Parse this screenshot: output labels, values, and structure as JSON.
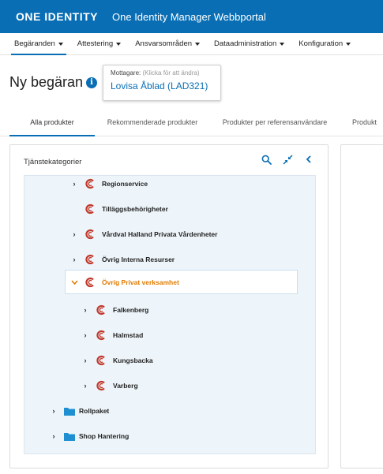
{
  "header": {
    "logo_text": "ONE IDENTITY",
    "app_title": "One Identity Manager Webbportal"
  },
  "menu": {
    "items": [
      {
        "label": "Begäranden"
      },
      {
        "label": "Attestering"
      },
      {
        "label": "Ansvarsområden"
      },
      {
        "label": "Dataadministration"
      },
      {
        "label": "Konfiguration"
      }
    ]
  },
  "page": {
    "title": "Ny begäran",
    "info_icon": "i"
  },
  "recipient": {
    "label": "Mottagare:",
    "hint": "(Klicka för att ändra)",
    "value": "Lovisa Åblad (LAD321)"
  },
  "tabs": [
    {
      "label": "Alla produkter"
    },
    {
      "label": "Rekommenderade produkter"
    },
    {
      "label": "Produkter per referensanvändare"
    },
    {
      "label": "Produkt"
    }
  ],
  "panel": {
    "title": "Tjänstekategorier",
    "tools": [
      "search-icon",
      "collapse-icon",
      "chevron-left-icon"
    ]
  },
  "tree": {
    "items": [
      {
        "label": "Regionservice",
        "expander": "›",
        "icon": "category-icon"
      },
      {
        "label": "Tilläggsbehörigheter",
        "expander": "",
        "icon": "category-icon"
      },
      {
        "label": "Vårdval Halland Privata Vårdenheter",
        "expander": "›",
        "icon": "category-icon"
      },
      {
        "label": "Övrig Interna Resurser",
        "expander": "›",
        "icon": "category-icon"
      },
      {
        "label": "Övrig Privat verksamhet",
        "expander": "⌄",
        "icon": "category-icon"
      },
      {
        "label": "Falkenberg",
        "expander": "›",
        "icon": "category-icon"
      },
      {
        "label": "Halmstad",
        "expander": "›",
        "icon": "category-icon"
      },
      {
        "label": "Kungsbacka",
        "expander": "›",
        "icon": "category-icon"
      },
      {
        "label": "Varberg",
        "expander": "›",
        "icon": "category-icon"
      },
      {
        "label": "Rollpaket",
        "expander": "›",
        "icon": "folder-icon"
      },
      {
        "label": "Shop Hantering",
        "expander": "›",
        "icon": "folder-icon"
      }
    ]
  },
  "colors": {
    "brand": "#0a6eb4",
    "selected_text": "#e07b00",
    "category_icon": "#c0392b",
    "folder": "#1f8fd1"
  }
}
